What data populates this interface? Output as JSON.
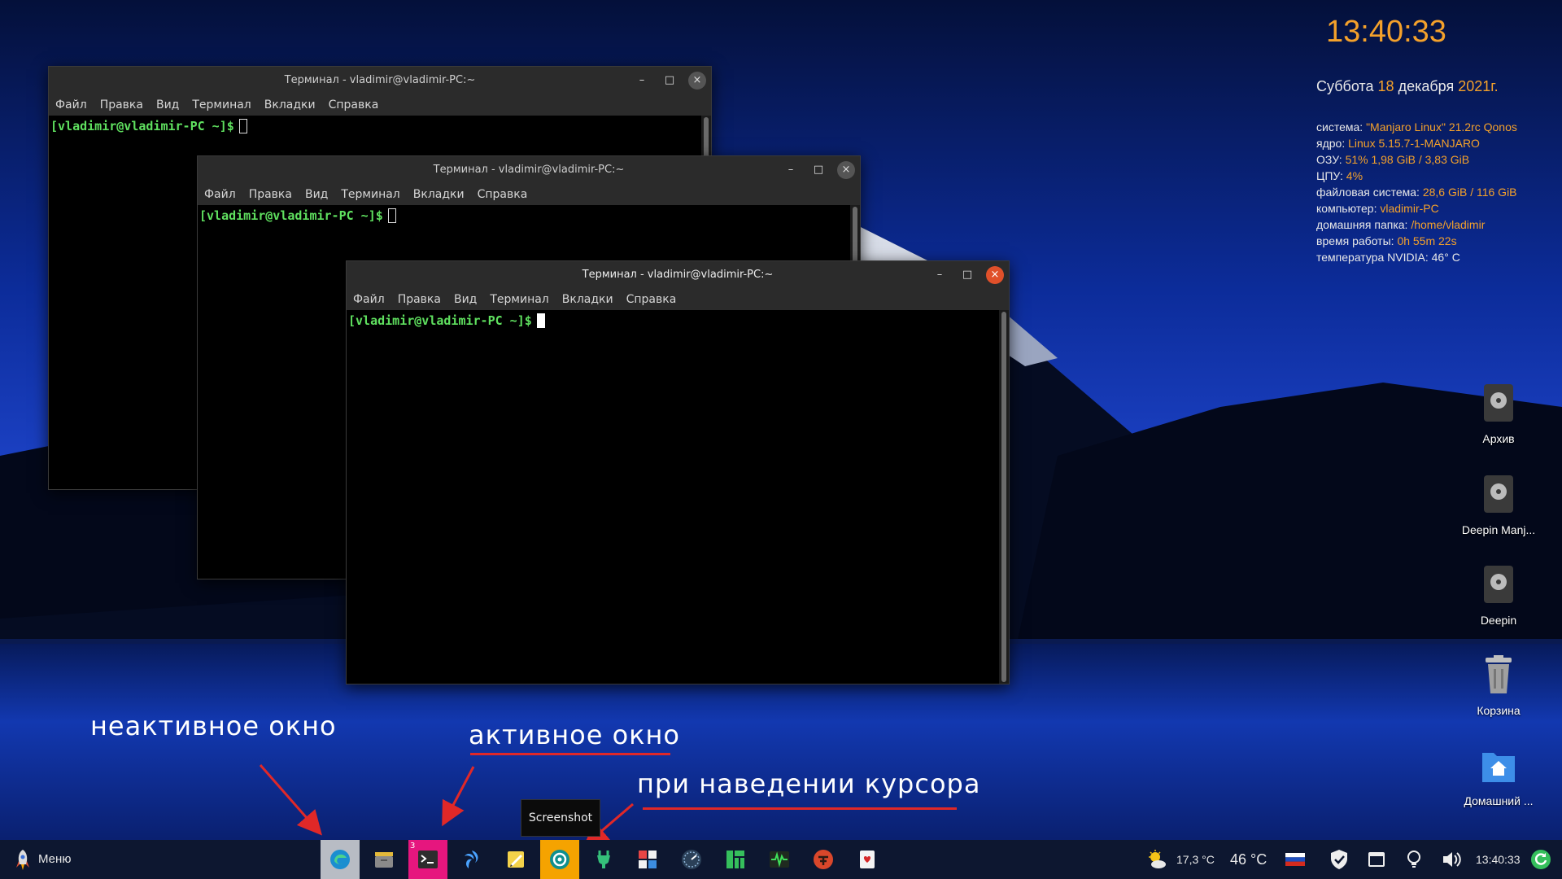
{
  "windows": [
    {
      "title": "Терминал - vladimir@vladimir-PC:~",
      "prompt": "[vladimir@vladimir-PC ~]$",
      "ctl_min": "–",
      "ctl_max": "□",
      "ctl_close": "×"
    },
    {
      "title": "Терминал - vladimir@vladimir-PC:~",
      "prompt": "[vladimir@vladimir-PC ~]$",
      "ctl_min": "–",
      "ctl_max": "□",
      "ctl_close": "×"
    },
    {
      "title": "Терминал - vladimir@vladimir-PC:~",
      "prompt": "[vladimir@vladimir-PC ~]$",
      "ctl_min": "–",
      "ctl_max": "□",
      "ctl_close": "×"
    }
  ],
  "menu": [
    "Файл",
    "Правка",
    "Вид",
    "Терминал",
    "Вкладки",
    "Справка"
  ],
  "conky": {
    "time": "13:40:33",
    "weekday": "Суббота",
    "day": "18",
    "month": "декабря",
    "year": "2021г.",
    "rows": [
      {
        "label": "система: ",
        "value": "\"Manjaro Linux\" 21.2rc Qonos"
      },
      {
        "label": "ядро: ",
        "value": "Linux 5.15.7-1-MANJARO"
      },
      {
        "label": "ОЗУ: ",
        "value": "51% 1,98 GiB / 3,83 GiB"
      },
      {
        "label": "ЦПУ: ",
        "value": "4%"
      },
      {
        "label": "файловая система: ",
        "value": "28,6 GiB / 116 GiB"
      },
      {
        "label": "компьютер: ",
        "value": "vladimir-PC"
      },
      {
        "label": "домашняя папка: ",
        "value": "/home/vladimir"
      },
      {
        "label": "время работы: ",
        "value": "0h 55m 22s"
      },
      {
        "label": "температура NVIDIA: 46° C",
        "value": ""
      }
    ]
  },
  "desktop_icons": [
    {
      "label": "Архив",
      "icon": "drive-icon"
    },
    {
      "label": "Deepin Manj...",
      "icon": "drive-icon"
    },
    {
      "label": "Deepin",
      "icon": "drive-icon"
    },
    {
      "label": "Корзина",
      "icon": "trash-icon"
    },
    {
      "label": "Домашний ...",
      "icon": "home-folder-icon"
    }
  ],
  "annotations": {
    "inactive": "неактивное окно",
    "active": "активное окно",
    "hover": "при наведении курсора"
  },
  "tooltip": "Screenshot",
  "taskbar": {
    "menu_label": "Меню",
    "terminal_badge": "3",
    "weather": "17,3 °C",
    "gpu_temp": "46 °C",
    "clock": "13:40:33",
    "accent": "#f4a12b",
    "active_highlight": "#e6167e",
    "hover_highlight": "#f5a300"
  }
}
